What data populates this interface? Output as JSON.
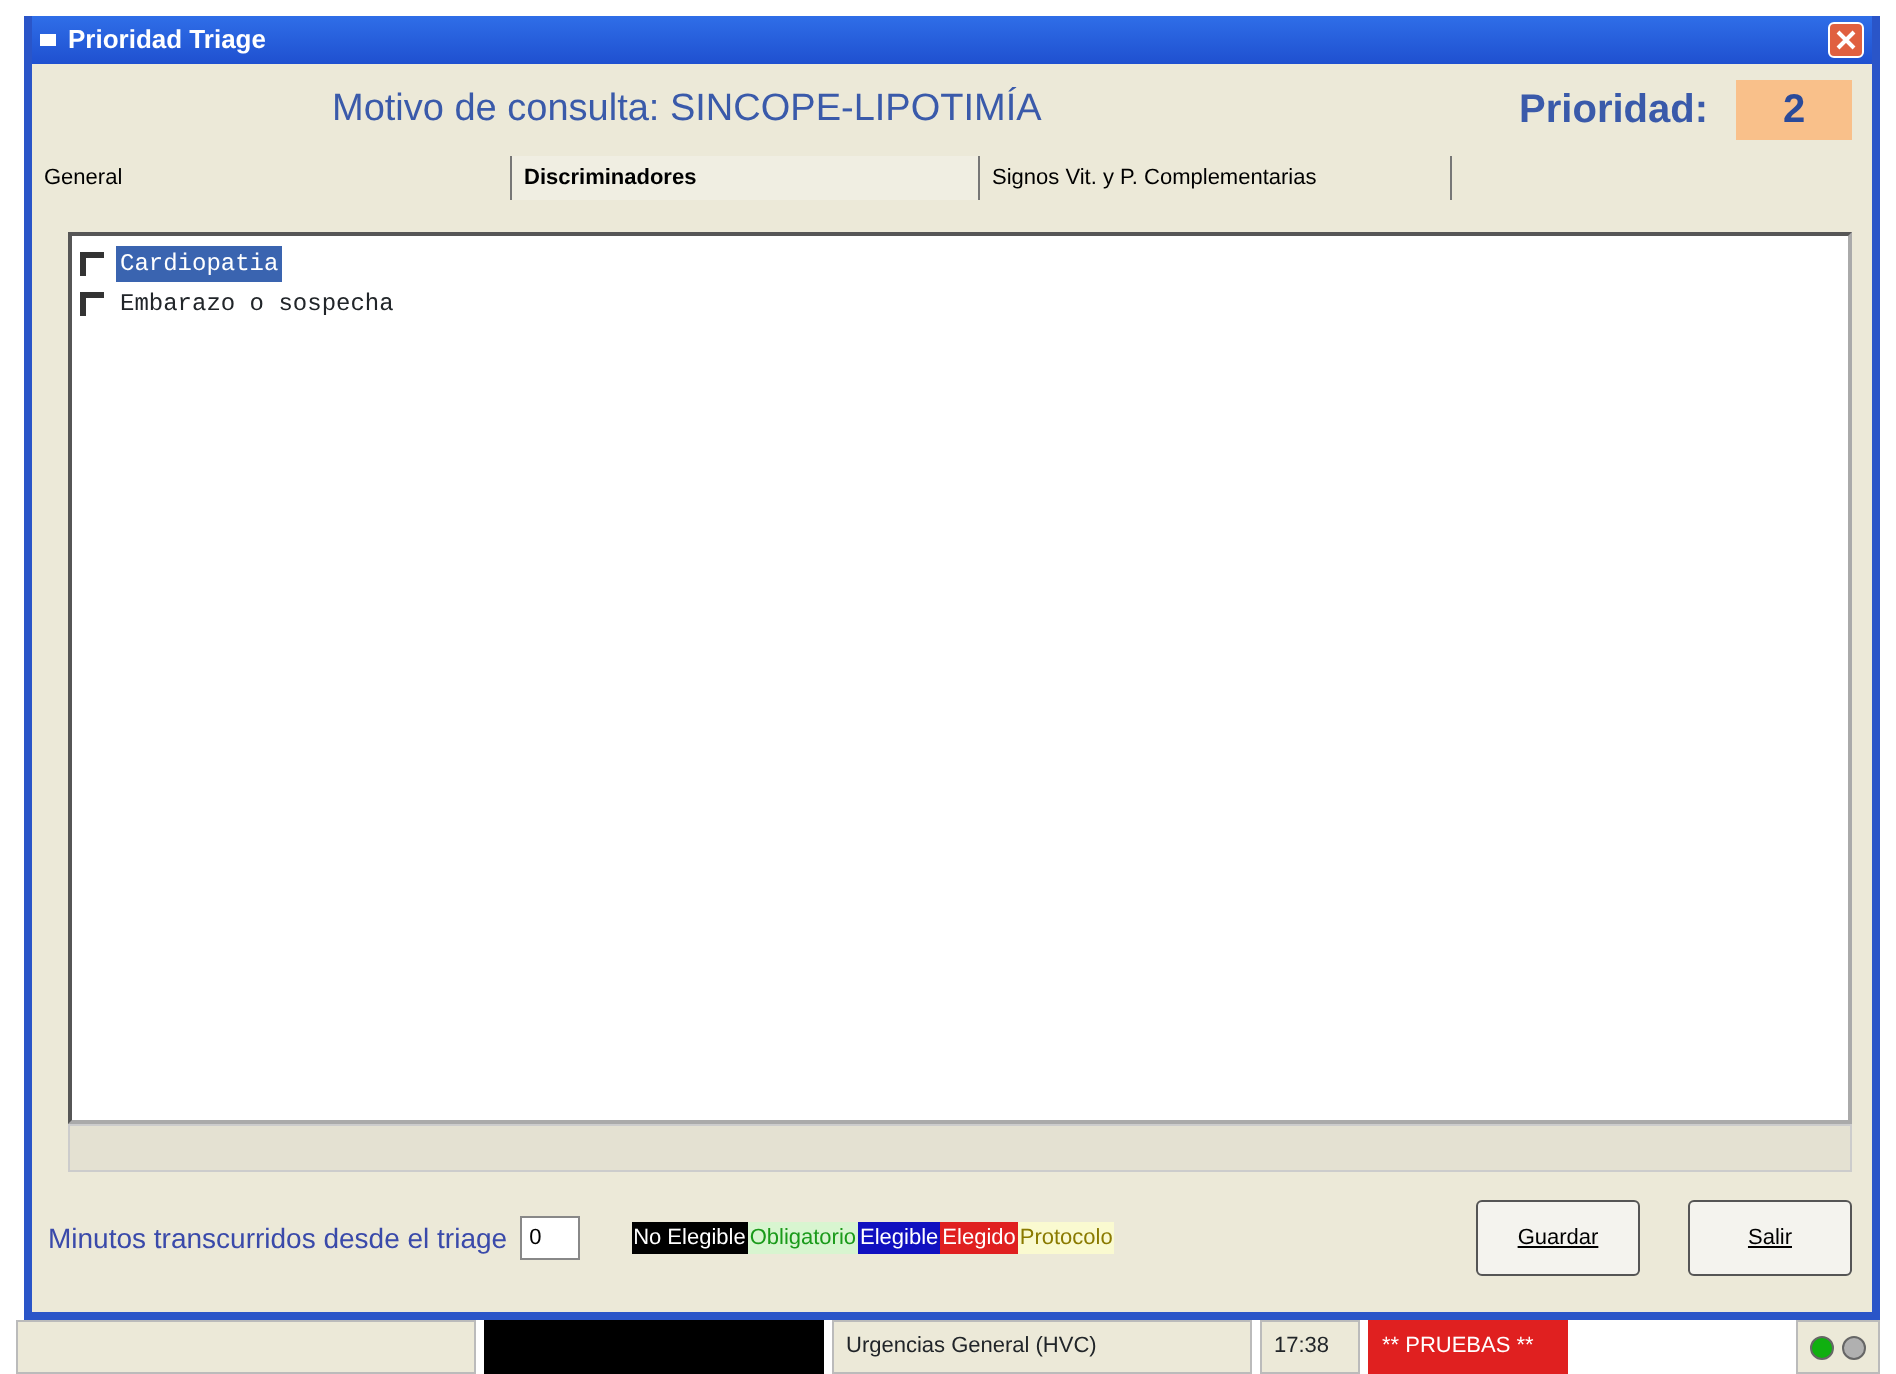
{
  "window": {
    "title": "Prioridad Triage"
  },
  "header": {
    "motivo": "Motivo de consulta: SINCOPE-LIPOTIMÍA",
    "priority_label": "Prioridad:",
    "priority_value": "2"
  },
  "tabs": [
    {
      "label": "General",
      "selected": false
    },
    {
      "label": "Discriminadores",
      "selected": true
    },
    {
      "label": "Signos Vit. y P. Complementarias",
      "selected": false
    }
  ],
  "discriminators": [
    {
      "label": "Cardiopatia",
      "checked": false,
      "selected": true
    },
    {
      "label": "Embarazo o sospecha",
      "checked": false,
      "selected": false
    }
  ],
  "footer": {
    "minutes_label": "Minutos transcurridos desde el triage",
    "minutes_value": "0",
    "legend": [
      {
        "label": "No Elegible",
        "color": "#000000"
      },
      {
        "label": "Obligatorio",
        "color": "#d8f5d0"
      },
      {
        "label": "Elegible",
        "color": "#1010c0"
      },
      {
        "label": "Elegido",
        "color": "#e02020"
      },
      {
        "label": "Protocolo",
        "color": "#fafad0"
      }
    ],
    "buttons": [
      "Guardar",
      "Salir"
    ]
  },
  "status_bar": {
    "cells": [
      {
        "kind": "text",
        "text": ""
      },
      {
        "kind": "black"
      },
      {
        "kind": "text",
        "text": "Urgencias General (HVC)"
      },
      {
        "kind": "text",
        "text": "17:38"
      },
      {
        "kind": "alert",
        "text": "** PRUEBAS **"
      }
    ],
    "indicators": [
      {
        "color": "#10b010"
      },
      {
        "color": "#b0b0b0"
      }
    ]
  }
}
